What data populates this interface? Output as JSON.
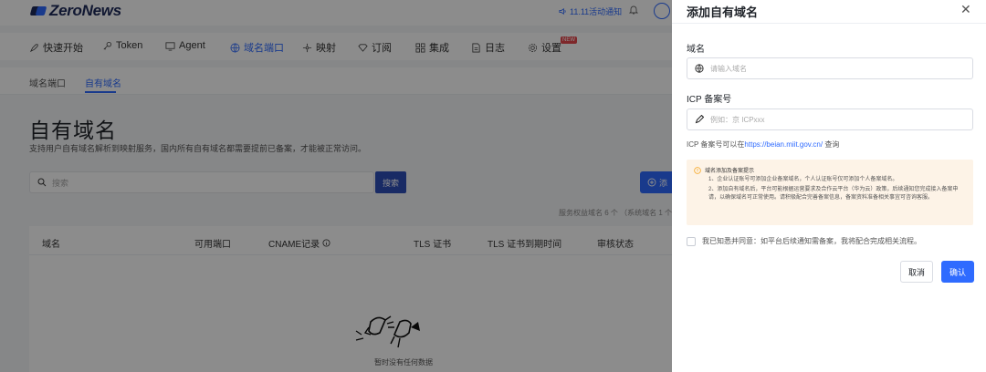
{
  "brand": {
    "name": "ZeroNews"
  },
  "topbar": {
    "notice": "11.11活动通知"
  },
  "nav": {
    "items": [
      {
        "label": "快速开始",
        "icon": "rocket-icon"
      },
      {
        "label": "Token",
        "icon": "key-icon"
      },
      {
        "label": "Agent",
        "icon": "monitor-icon"
      },
      {
        "label": "域名端口",
        "icon": "globe-icon"
      },
      {
        "label": "映射",
        "icon": "network-icon"
      },
      {
        "label": "订阅",
        "icon": "diamond-icon"
      },
      {
        "label": "集成",
        "icon": "grid-icon"
      },
      {
        "label": "日志",
        "icon": "document-icon"
      },
      {
        "label": "设置",
        "icon": "gear-icon"
      }
    ],
    "active_index": 3,
    "new_badge": "NEW"
  },
  "subtabs": {
    "items": [
      "域名端口",
      "自有域名"
    ],
    "active_index": 1
  },
  "page": {
    "title": "自有域名",
    "description": "支持用户自有域名解析到映射服务，国内所有自有域名都需要提前已备案，才能被正常访问。",
    "search_placeholder": "搜索",
    "search_button": "搜索",
    "add_button": "添",
    "quota_text": "服务权益域名 6 个 （系统域名 1 个"
  },
  "table": {
    "headers": [
      "域名",
      "可用端口",
      "CNAME记录",
      "TLS 证书",
      "TLS 证书到期时间",
      "审核状态"
    ],
    "empty_text": "暂时没有任何数据"
  },
  "drawer": {
    "title": "添加自有域名",
    "domain_label": "域名",
    "domain_placeholder": "请输入域名",
    "icp_label": "ICP 备案号",
    "icp_placeholder": "例如：京 ICPxxx",
    "icp_hint_prefix": "ICP 备案号可以在",
    "icp_hint_link": "https://beian.miit.gov.cn/",
    "icp_hint_suffix": " 查询",
    "tip_title": "域名添加及备案提示",
    "tip_line1": "1、企业认证账号可添加企业备案域名，个人认证账号仅可添加个人备案域名。",
    "tip_line2": "2、添加自有域名后，平台可能根据运营要求及合作云平台（华为云）政策，后续通知您完成接入备案申请，以确保域名可正常使用。请积极配合完善备案信息，备案资料准备相关事宜可咨询客服。",
    "agree_text": "我已知悉并同意：如平台后续通知需备案，我将配合完成相关流程。",
    "cancel_button": "取消",
    "confirm_button": "确认"
  },
  "colors": {
    "accent": "#2f6bff",
    "warning_bg": "#fdf3e7",
    "warning_icon": "#f5a623"
  }
}
